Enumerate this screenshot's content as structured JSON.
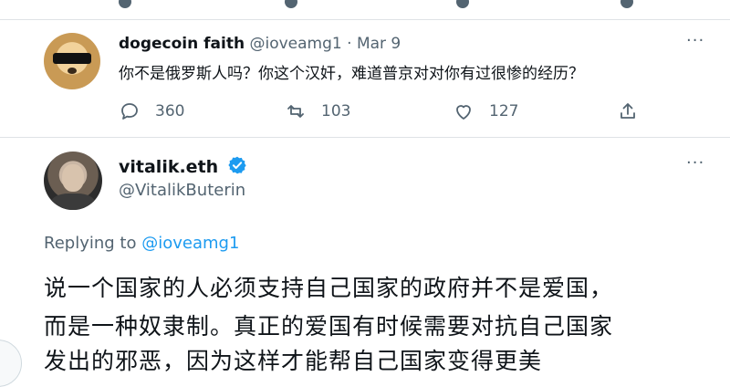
{
  "reply_tweet": {
    "display_name": "dogecoin faith",
    "handle": "@ioveamg1",
    "separator": "·",
    "date": "Mar 9",
    "text": "你不是俄罗斯人吗？你这个汉奸，难道普京对对你有过很惨的经历？",
    "actions": {
      "reply_count": "360",
      "retweet_count": "103",
      "like_count": "127"
    },
    "more_glyph": "···"
  },
  "main_tweet": {
    "display_name": "vitalik.eth",
    "handle": "@VitalikButerin",
    "replying_prefix": "Replying to",
    "replying_to": "@ioveamg1",
    "text_lines": [
      "说一个国家的人必须支持自己国家的政府并不是爱国，",
      "而是一种奴隶制。真正的爱国有时候需要对抗自己国家",
      "发出的邪恶，因为这样才能帮自己国家变得更美"
    ],
    "more_glyph": "···"
  },
  "colors": {
    "primary_text": "#0f1419",
    "secondary_text": "#536471",
    "accent": "#1d9bf0",
    "divider": "#dfe3e6"
  },
  "icons": [
    "reply-icon",
    "retweet-icon",
    "like-icon",
    "share-icon",
    "verified-badge-icon",
    "more-icon"
  ]
}
